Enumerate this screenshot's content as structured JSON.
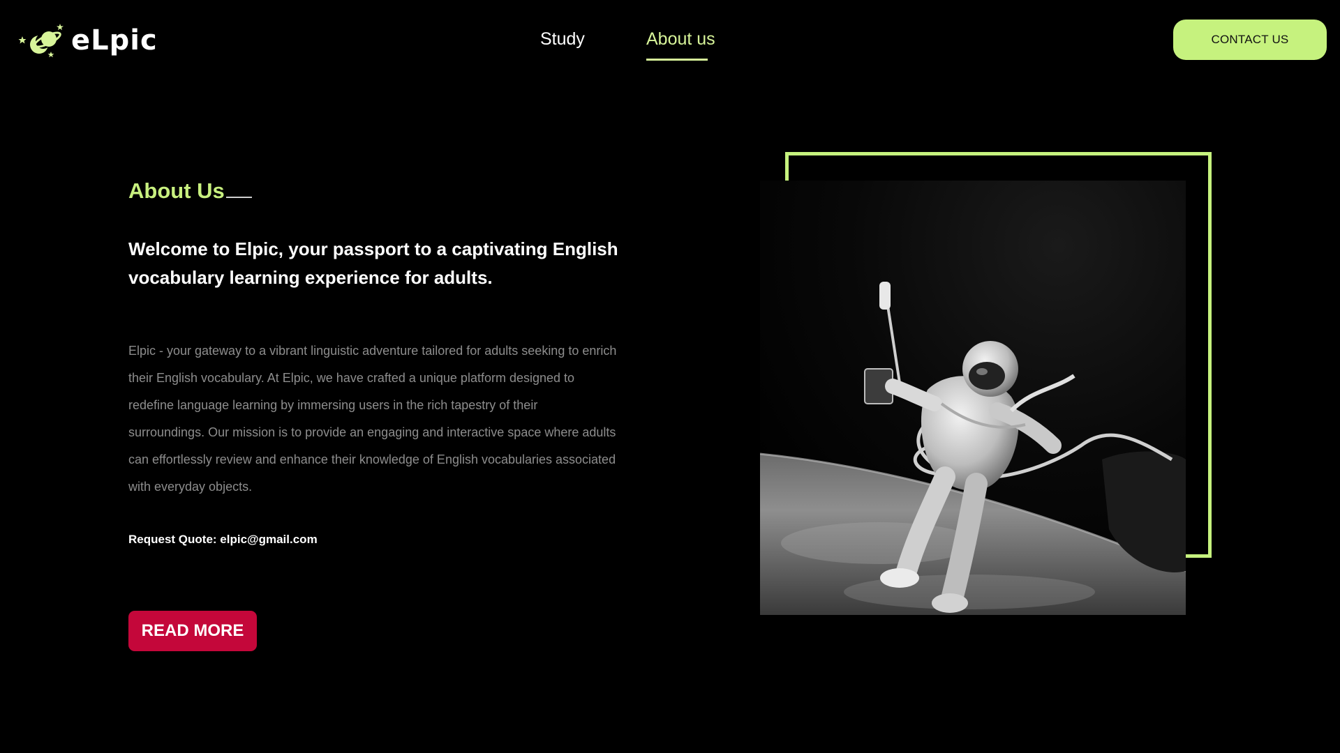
{
  "brand": {
    "name": "eLpic",
    "icon": "planet-with-stars-logo"
  },
  "nav": {
    "items": [
      {
        "label": "Study"
      },
      {
        "label": "About us"
      }
    ],
    "active": "About us"
  },
  "header": {
    "contact_label": "CONTACT US"
  },
  "about": {
    "section_title": "About Us",
    "headline": "Welcome to Elpic, your passport to a captivating English vocabulary learning experience for adults.",
    "description": "Elpic - your gateway to a vibrant linguistic adventure tailored for adults seeking to enrich their English vocabulary. At Elpic, we have crafted a unique platform designed to redefine language learning by immersing users in the rich tapestry of their surroundings. Our mission is to provide an engaging and interactive space where adults can effortlessly review and enhance their knowledge of English vocabularies associated with everyday objects.",
    "quote": "Request Quote: elpic@gmail.com",
    "read_more_label": "READ MORE"
  },
  "hero_image": {
    "subject": "astronaut-spacewalk-photo"
  },
  "colors": {
    "background": "#000000",
    "accent_green": "#c6f27e",
    "button_red": "#c4073a",
    "muted_text": "#8d8d8d"
  }
}
